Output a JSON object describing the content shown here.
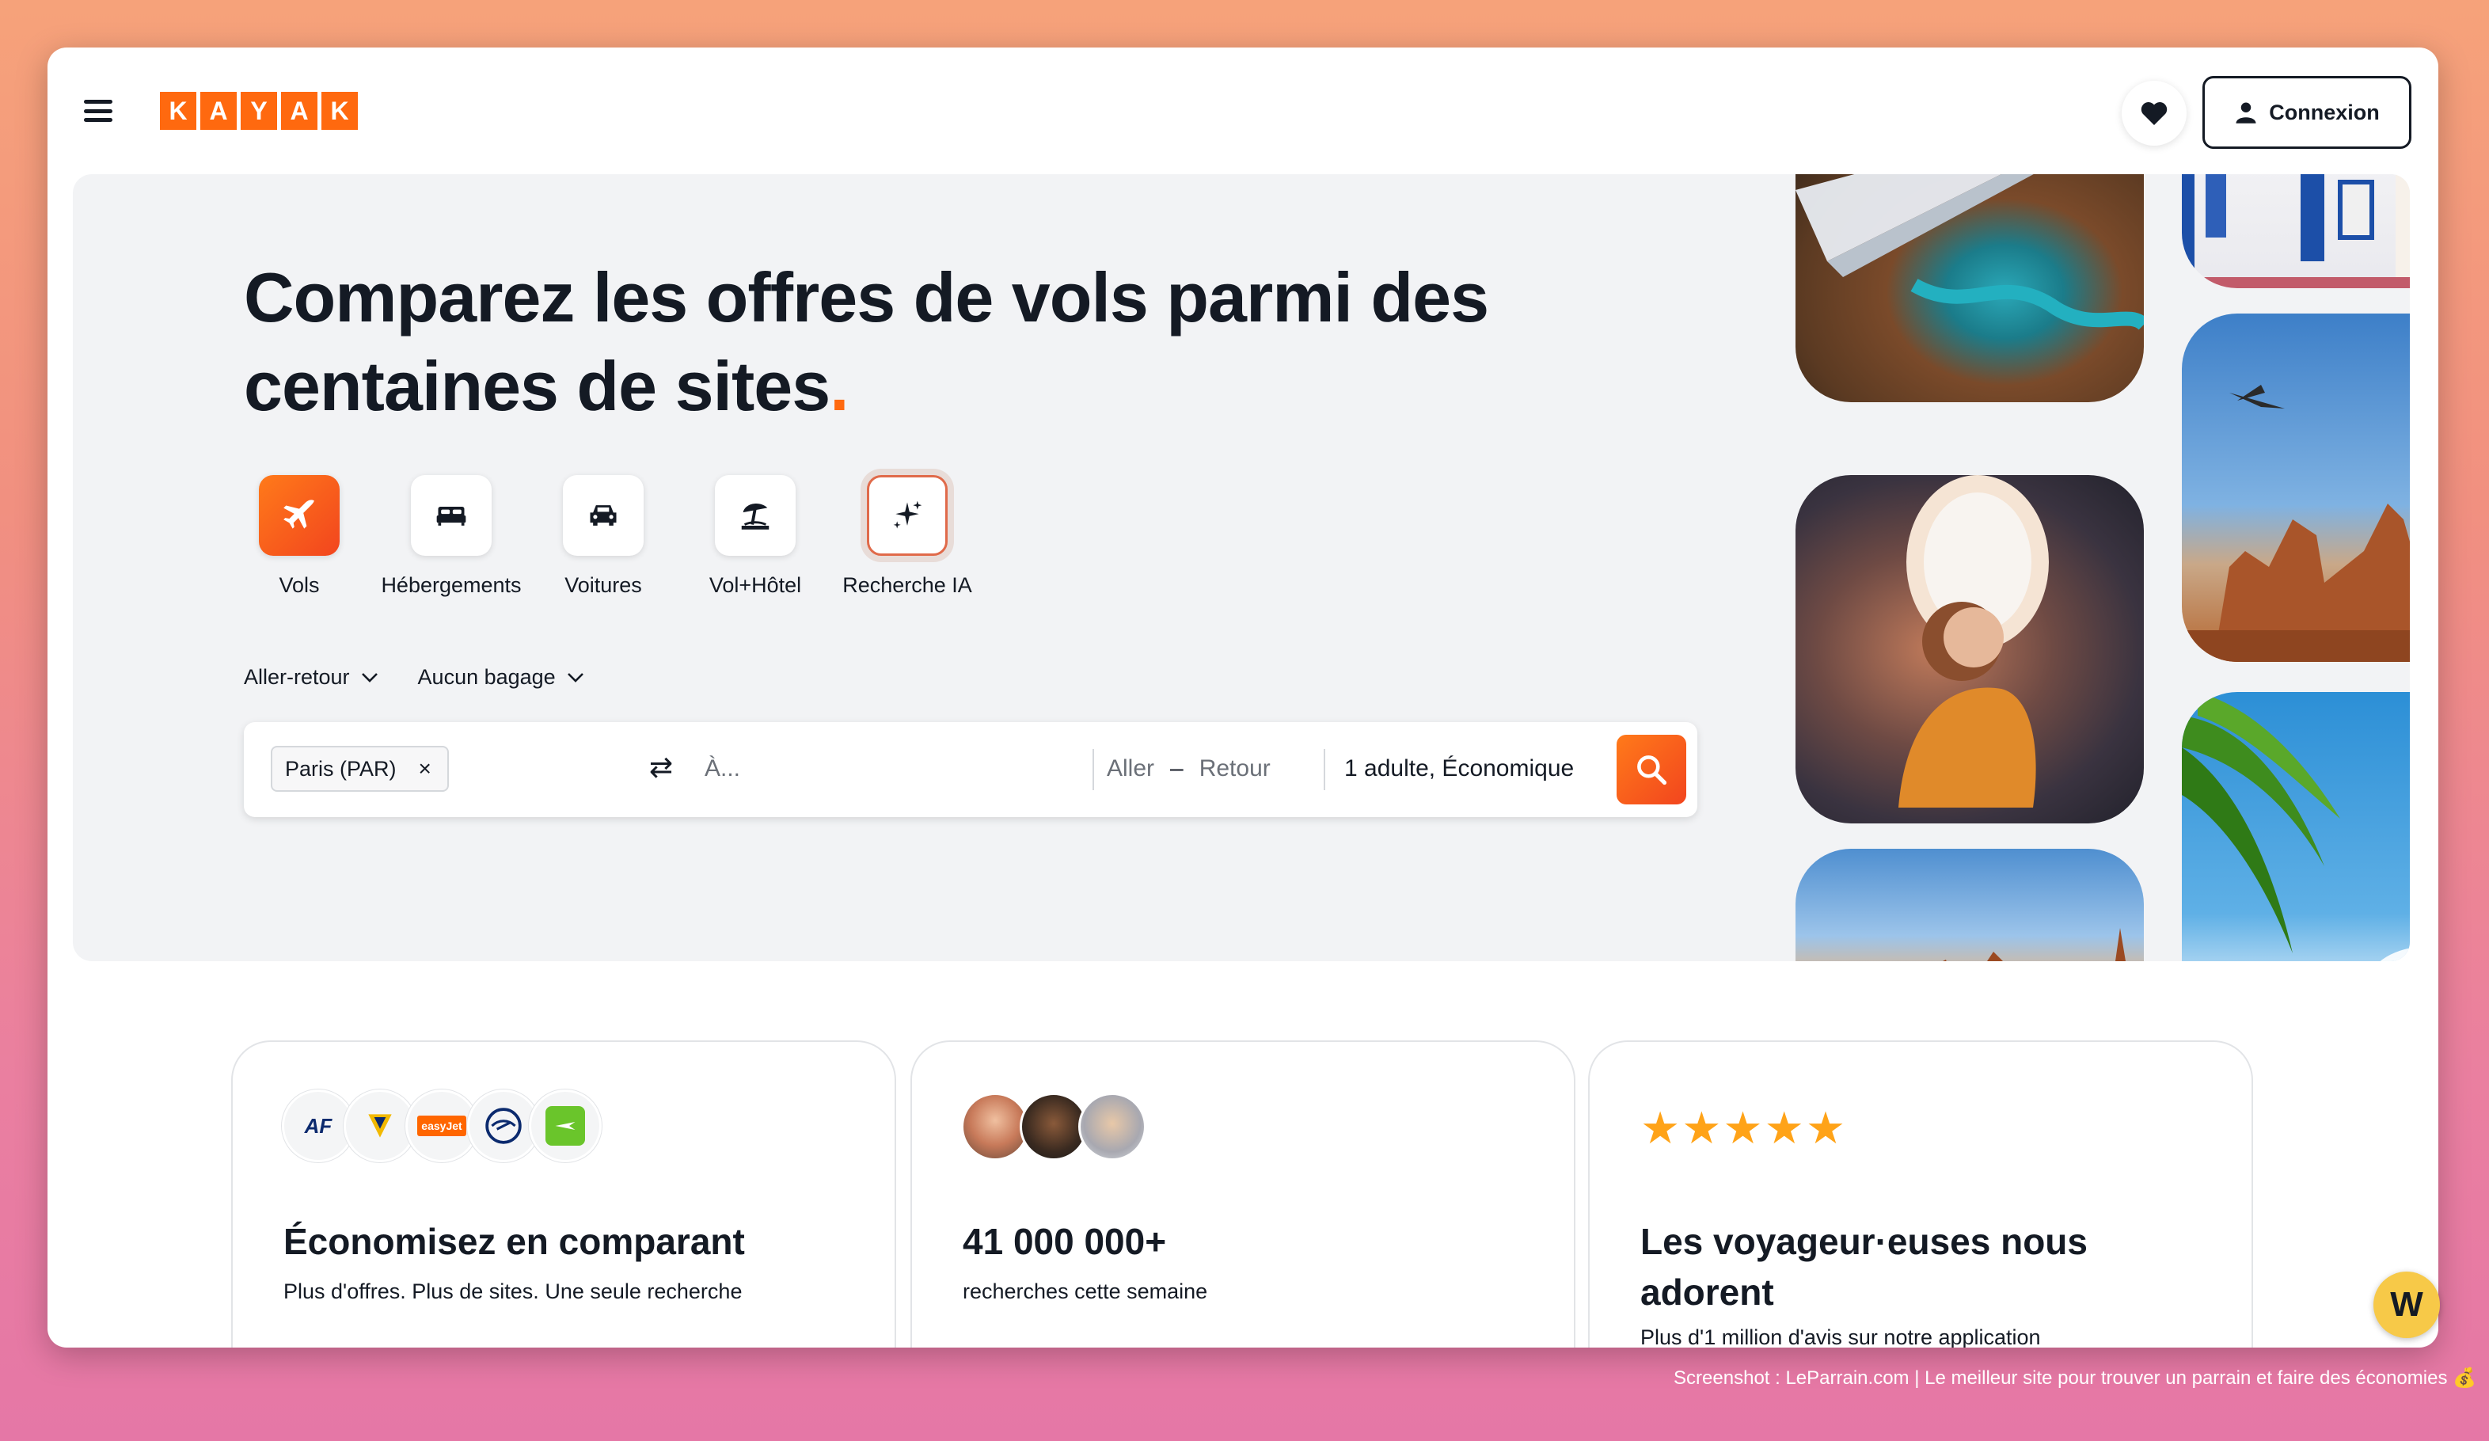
{
  "header": {
    "logo_letters": [
      "K",
      "A",
      "Y",
      "A",
      "K"
    ],
    "connect_label": "Connexion",
    "icons": {
      "menu": "hamburger-menu-icon",
      "favorites": "heart-icon",
      "user": "user-icon"
    }
  },
  "hero": {
    "title_main": "Comparez les offres de vols parmi des centaines de sites",
    "title_dot": ".",
    "categories": [
      {
        "label": "Vols",
        "icon": "plane-icon",
        "active": true
      },
      {
        "label": "Hébergements",
        "icon": "bed-icon"
      },
      {
        "label": "Voitures",
        "icon": "car-icon"
      },
      {
        "label": "Vol+Hôtel",
        "icon": "beach-umbrella-icon"
      },
      {
        "label": "Recherche IA",
        "icon": "sparkles-icon"
      }
    ],
    "options": {
      "trip_type": "Aller-retour",
      "baggage": "Aucun bagage"
    },
    "search": {
      "origin_chip": "Paris (PAR)",
      "chip_remove": "×",
      "swap_icon": "⇄",
      "destination_placeholder": "À...",
      "depart_placeholder": "Aller",
      "date_dash": "–",
      "return_placeholder": "Retour",
      "passengers": "1 adulte, Économique"
    },
    "photos": [
      "airplane-wing-canyon-photo",
      "white-blue-houses-photo",
      "desert-rocks-plane-photo",
      "child-window-plane-photo",
      "palm-tree-photo",
      "desert-buttes-photo"
    ]
  },
  "cards": [
    {
      "title": "Économisez en comparant",
      "subtitle": "Plus d'offres. Plus de sites. Une seule recherche",
      "airline_logos": [
        "AF",
        "Ryanair",
        "easyJet",
        "Lufthansa",
        "Transavia"
      ]
    },
    {
      "title": "41 000 000+",
      "subtitle": "recherches cette semaine"
    },
    {
      "stars": "★★★★★",
      "title": "Les voyageur·euses nous adorent",
      "subtitle": "Plus d'1 million d'avis sur notre application"
    }
  ],
  "overlay": {
    "badge_letter": "W",
    "footer_note": "Screenshot : LeParrain.com | Le meilleur site pour trouver un parrain et faire des économies 💰"
  },
  "colors": {
    "brand_orange": "#ff690f",
    "star_gold": "#ffa318",
    "text_dark": "#141a24",
    "hero_bg": "#f2f3f5"
  }
}
